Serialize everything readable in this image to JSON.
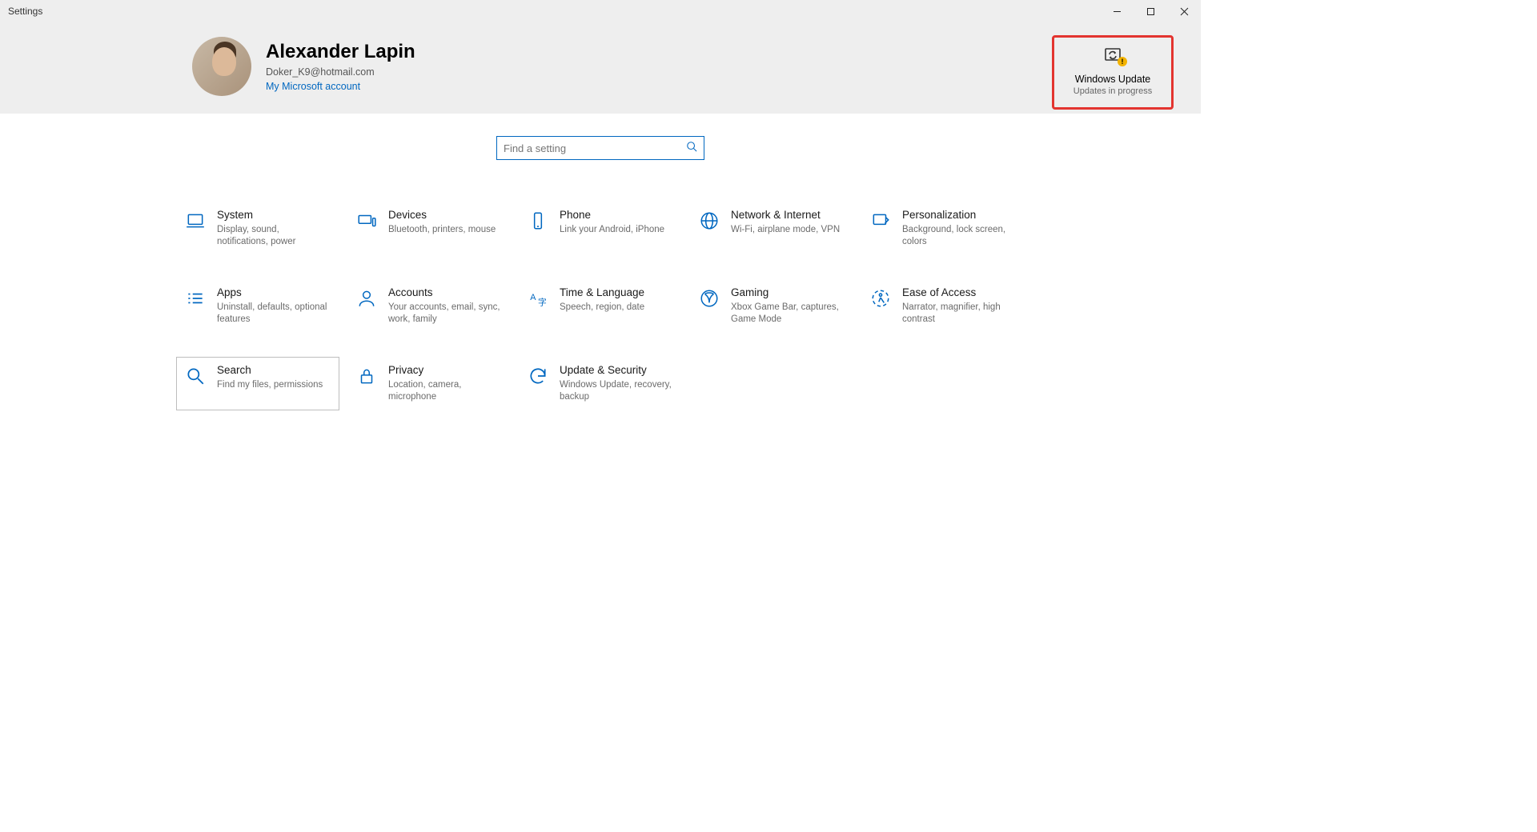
{
  "window": {
    "title": "Settings"
  },
  "user": {
    "name": "Alexander Lapin",
    "email": "Doker_K9@hotmail.com",
    "link_label": "My Microsoft account"
  },
  "update_tile": {
    "title": "Windows Update",
    "subtitle": "Updates in progress"
  },
  "search": {
    "placeholder": "Find a setting"
  },
  "tiles": [
    {
      "id": "system",
      "title": "System",
      "desc": "Display, sound, notifications, power"
    },
    {
      "id": "devices",
      "title": "Devices",
      "desc": "Bluetooth, printers, mouse"
    },
    {
      "id": "phone",
      "title": "Phone",
      "desc": "Link your Android, iPhone"
    },
    {
      "id": "network",
      "title": "Network & Internet",
      "desc": "Wi-Fi, airplane mode, VPN"
    },
    {
      "id": "personalization",
      "title": "Personalization",
      "desc": "Background, lock screen, colors"
    },
    {
      "id": "apps",
      "title": "Apps",
      "desc": "Uninstall, defaults, optional features"
    },
    {
      "id": "accounts",
      "title": "Accounts",
      "desc": "Your accounts, email, sync, work, family"
    },
    {
      "id": "time",
      "title": "Time & Language",
      "desc": "Speech, region, date"
    },
    {
      "id": "gaming",
      "title": "Gaming",
      "desc": "Xbox Game Bar, captures, Game Mode"
    },
    {
      "id": "ease",
      "title": "Ease of Access",
      "desc": "Narrator, magnifier, high contrast"
    },
    {
      "id": "search",
      "title": "Search",
      "desc": "Find my files, permissions"
    },
    {
      "id": "privacy",
      "title": "Privacy",
      "desc": "Location, camera, microphone"
    },
    {
      "id": "update",
      "title": "Update & Security",
      "desc": "Windows Update, recovery, backup"
    }
  ]
}
